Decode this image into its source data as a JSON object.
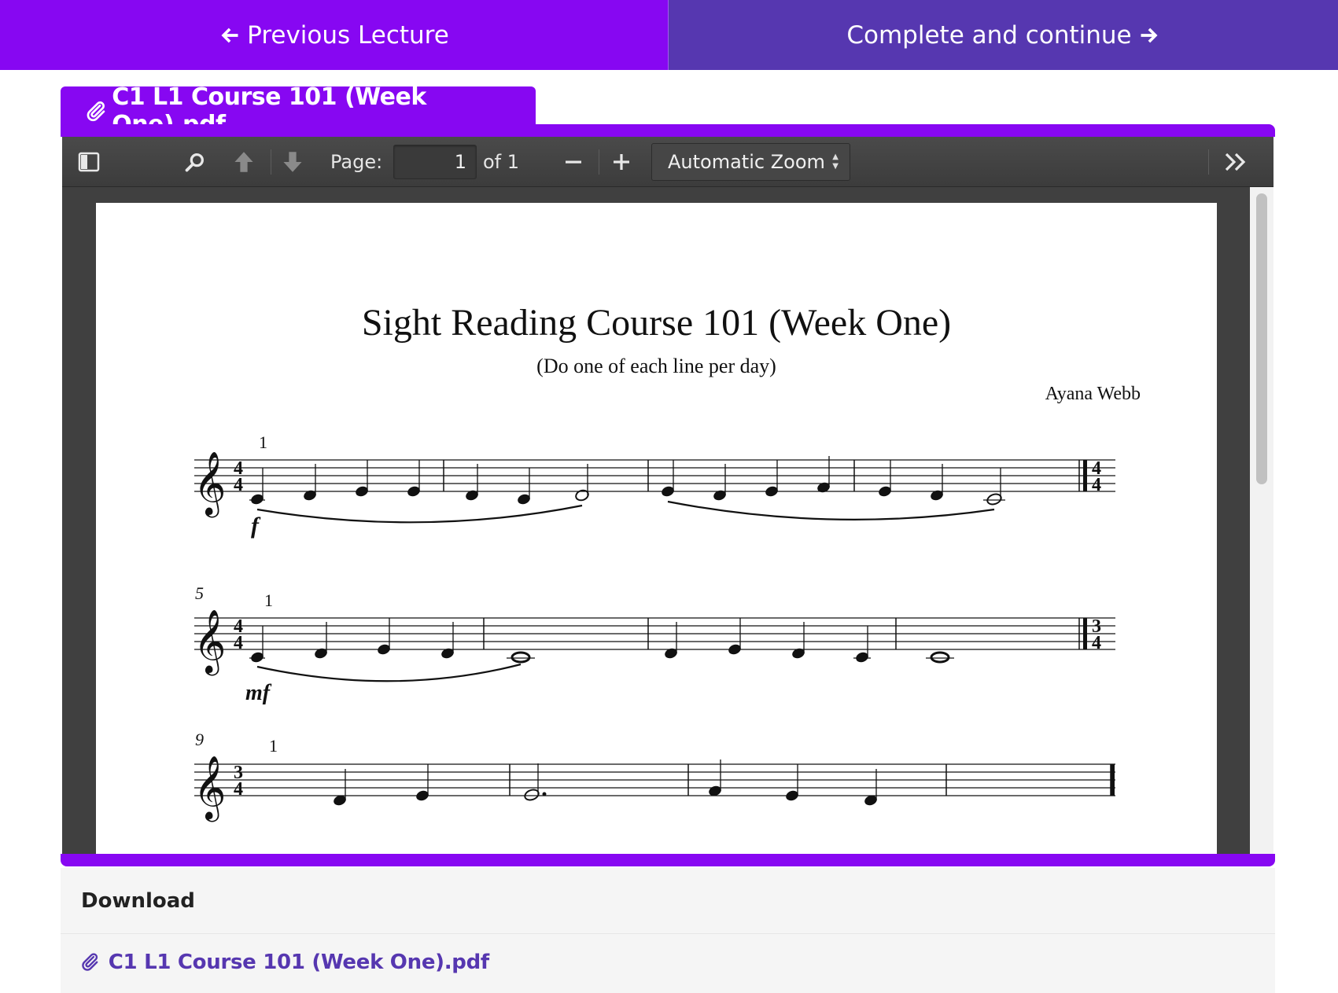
{
  "nav": {
    "prev_label": "Previous Lecture",
    "next_label": "Complete and continue"
  },
  "attachment": {
    "file_name": "C1 L1 Course 101 (Week One).pdf"
  },
  "pdf_toolbar": {
    "page_label": "Page:",
    "page_value": "1",
    "page_total": "of 1",
    "zoom_label": "Automatic Zoom"
  },
  "pdf_page": {
    "title": "Sight Reading Course 101 (Week One)",
    "subtitle": "(Do one of each line per day)",
    "author": "Ayana Webb",
    "systems": [
      {
        "measure_number": "",
        "fingering": "1",
        "time_sig": [
          "4",
          "4"
        ],
        "end_time_sig": [
          "4",
          "4"
        ],
        "dynamic": "f"
      },
      {
        "measure_number": "5",
        "fingering": "1",
        "time_sig": [
          "4",
          "4"
        ],
        "end_time_sig": [
          "3",
          "4"
        ],
        "dynamic": "mf"
      },
      {
        "measure_number": "9",
        "fingering": "1",
        "time_sig": [
          "3",
          "4"
        ],
        "end_time_sig": null,
        "dynamic": ""
      }
    ]
  },
  "download": {
    "heading": "Download",
    "file_name": "C1 L1 Course 101 (Week One).pdf"
  },
  "colors": {
    "brand_purple": "#8707f2",
    "indigo": "#5637b0",
    "viewer_dark": "#404040"
  }
}
